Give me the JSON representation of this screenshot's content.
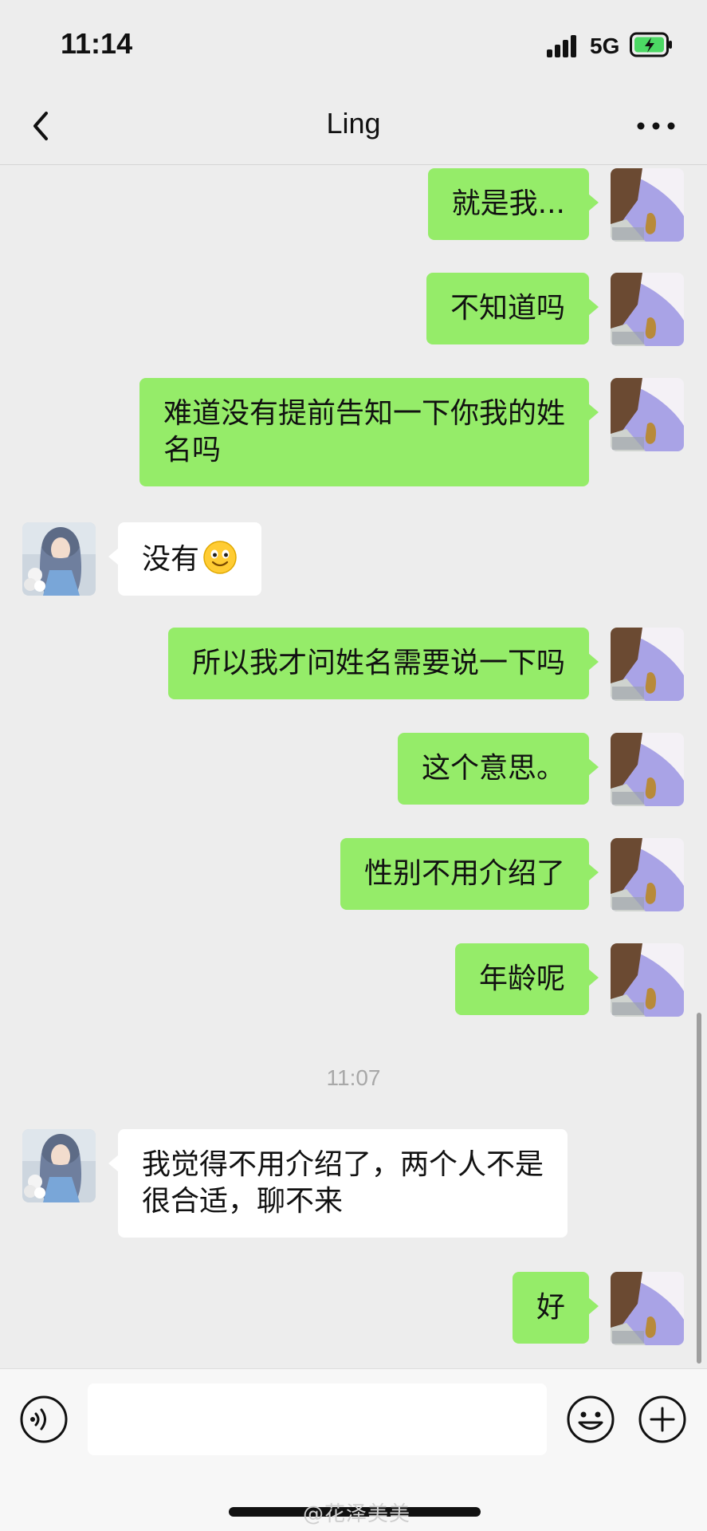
{
  "status_bar": {
    "time": "11:14",
    "network": "5G"
  },
  "header": {
    "title": "Ling"
  },
  "messages": [
    {
      "side": "me",
      "text": "就是我..."
    },
    {
      "side": "me",
      "text": "不知道吗"
    },
    {
      "side": "me",
      "line1": "难道没有提前告知一下你我的姓",
      "line2": "名吗"
    },
    {
      "side": "them",
      "text": "没有",
      "emoji": "smiling-face-icon"
    },
    {
      "side": "me",
      "text": "所以我才问姓名需要说一下吗"
    },
    {
      "side": "me",
      "text": "这个意思。"
    },
    {
      "side": "me",
      "text": "性别不用介绍了"
    },
    {
      "side": "me",
      "text": "年龄呢"
    },
    {
      "side": "them",
      "line1": "我觉得不用介绍了，两个人不是",
      "line2": "很合适，聊不来"
    },
    {
      "side": "me",
      "text": "好"
    }
  ],
  "timestamp": "11:07",
  "input": {
    "value": "",
    "placeholder": ""
  },
  "watermark": "@花泽美美",
  "colors": {
    "my_bubble": "#95ec69",
    "their_bubble": "#ffffff",
    "background": "#ededed"
  }
}
